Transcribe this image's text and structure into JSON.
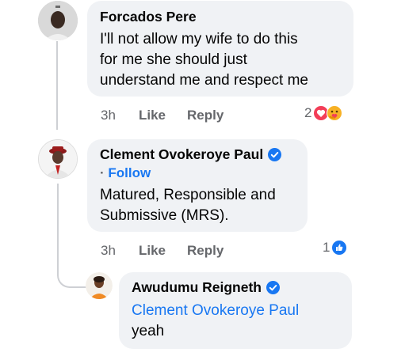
{
  "comments": [
    {
      "author": "Forcados Pere",
      "text_lines": [
        "I'll not allow my wife to do this",
        "for me  she should just",
        "understand me and respect me"
      ],
      "time": "3h",
      "like_label": "Like",
      "reply_label": "Reply",
      "reaction_count": "2",
      "reaction_icons": [
        "love-reaction",
        "care-reaction"
      ]
    },
    {
      "author": "Clement Ovokeroye Paul",
      "verified": true,
      "follow_label": "Follow",
      "text_lines": [
        "Matured, Responsible and",
        "Submissive (MRS)."
      ],
      "time": "3h",
      "like_label": "Like",
      "reply_label": "Reply",
      "reaction_count": "1",
      "reaction_icons": [
        "like-reaction"
      ]
    }
  ],
  "reply": {
    "author": "Awudumu Reigneth",
    "verified": true,
    "mention": "Clement Ovokeroye Paul",
    "text": "yeah"
  },
  "colors": {
    "bubble": "#f0f2f5",
    "link": "#1877f2",
    "meta": "#65676b",
    "love": "#f33e58",
    "care": "#f7b125"
  }
}
